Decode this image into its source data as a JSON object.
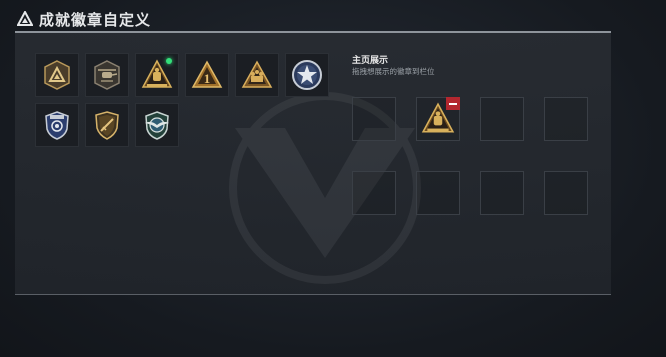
{
  "header": {
    "title": "成就徽章自定义"
  },
  "badges": [
    {
      "icon": "triangle-emblem-icon",
      "new": false
    },
    {
      "icon": "helicopter-emblem-icon",
      "new": false
    },
    {
      "icon": "gold-squad-emblem-icon",
      "new": true
    },
    {
      "icon": "gold-number-one-emblem-icon",
      "new": false
    },
    {
      "icon": "gold-soldiers-emblem-icon",
      "new": false
    },
    {
      "icon": "silver-star-emblem-icon",
      "new": false
    },
    {
      "icon": "police-shield-emblem-icon",
      "new": false
    },
    {
      "icon": "rifle-shield-emblem-icon",
      "new": false
    },
    {
      "icon": "silver-wings-emblem-icon",
      "new": false
    }
  ],
  "showcase": {
    "title": "主页展示",
    "subtitle": "拖拽想展示的徽章到栏位",
    "slots": [
      "",
      "gold-squad-emblem-icon",
      "",
      "",
      "",
      "",
      "",
      ""
    ]
  },
  "colors": {
    "gold": "#c9a250",
    "new_dot": "#33e07a",
    "remove": "#b3272f",
    "accent_line": "#8e949b"
  }
}
